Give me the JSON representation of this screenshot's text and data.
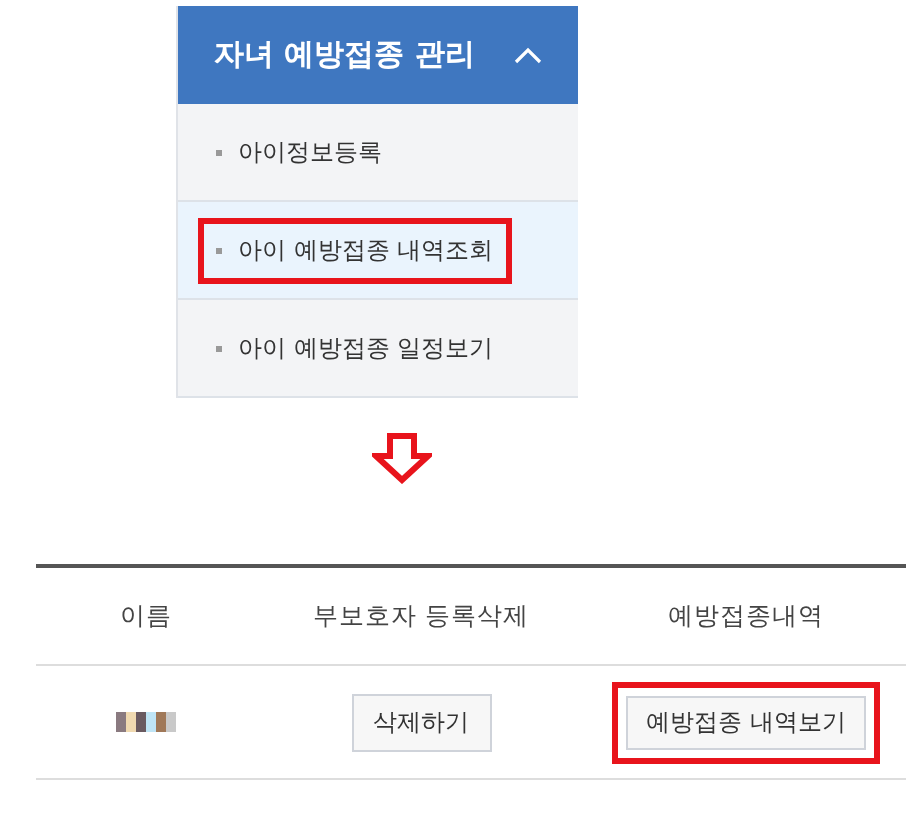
{
  "menu": {
    "title": "자녀 예방접종 관리",
    "expanded": true,
    "items": [
      {
        "label": "아이정보등록",
        "selected": false,
        "highlighted": false
      },
      {
        "label": "아이 예방접종 내역조회",
        "selected": true,
        "highlighted": true
      },
      {
        "label": "아이 예방접종 일정보기",
        "selected": false,
        "highlighted": false
      }
    ]
  },
  "table": {
    "columns": [
      "이름",
      "부보호자 등록삭제",
      "예방접종내역"
    ],
    "rows": [
      {
        "delete_button": {
          "label": "삭제하기",
          "highlighted": false
        },
        "history_button": {
          "label": "예방접종 내역보기",
          "highlighted": true
        }
      }
    ]
  }
}
